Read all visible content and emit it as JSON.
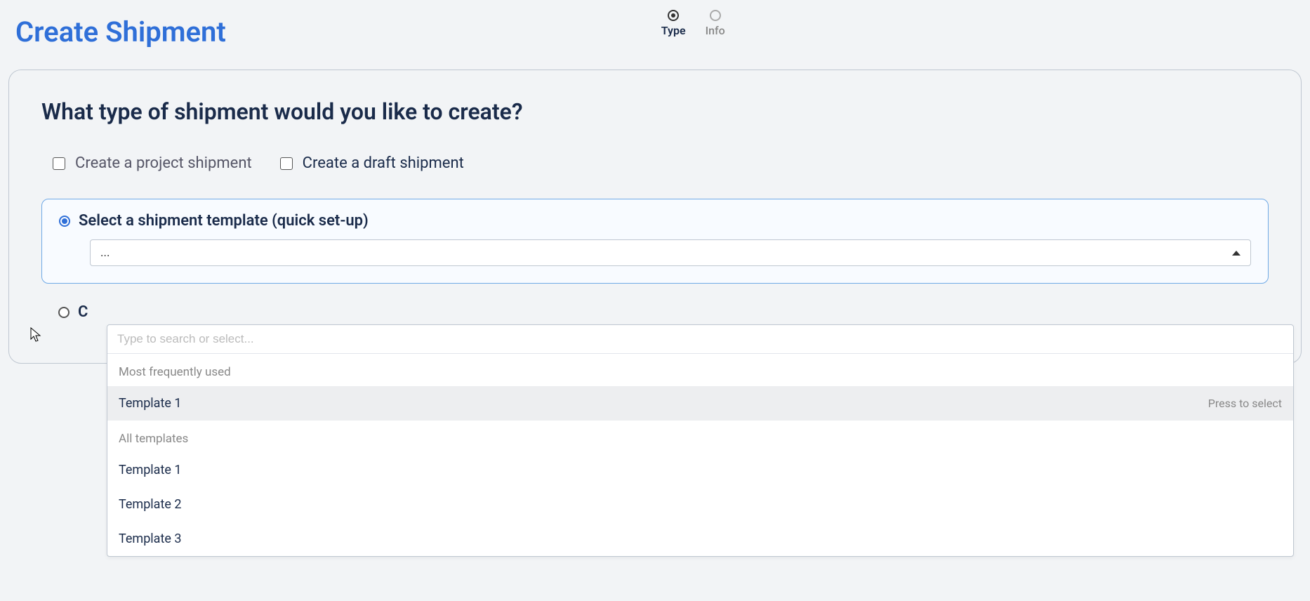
{
  "page": {
    "title": "Create Shipment"
  },
  "stepper": {
    "steps": [
      {
        "label": "Type",
        "active": true
      },
      {
        "label": "Info",
        "active": false
      }
    ]
  },
  "panel": {
    "heading": "What type of shipment would you like to create?",
    "checks": {
      "project": "Create a project shipment",
      "draft": "Create a draft shipment"
    },
    "template_radio_label": "Select a shipment template (quick set-up)",
    "select_value": "...",
    "other_radio_partial": "C"
  },
  "dropdown": {
    "search_placeholder": "Type to search or select...",
    "group_frequent": "Most frequently used",
    "group_all": "All templates",
    "frequent_items": [
      "Template 1"
    ],
    "all_items": [
      "Template 1",
      "Template 2",
      "Template 3"
    ],
    "hint": "Press to select"
  }
}
